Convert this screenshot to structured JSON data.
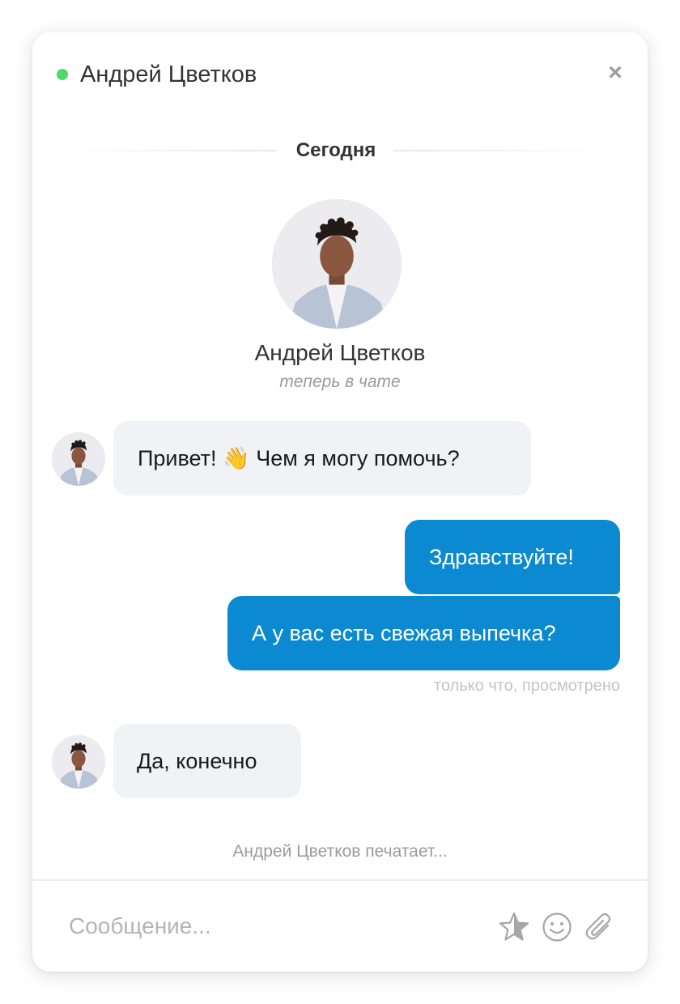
{
  "header": {
    "title": "Андрей Цветков",
    "status_icon": "online-dot",
    "online_color": "#4cd964",
    "close_label": "×"
  },
  "divider": {
    "label": "Сегодня"
  },
  "agent": {
    "name": "Андрей Цветков",
    "status": "теперь в чате"
  },
  "messages": [
    {
      "direction": "incoming",
      "text_before": "Привет!",
      "emoji": "👋",
      "text_after": "Чем я могу помочь?"
    },
    {
      "direction": "outgoing",
      "text": "Здравствуйте!"
    },
    {
      "direction": "outgoing",
      "text": "А у вас есть свежая выпечка?"
    },
    {
      "direction": "incoming",
      "text": "Да, конечно"
    }
  ],
  "outgoing_meta": "только что, просмотрено",
  "typing_indicator": "Андрей Цветков печатает...",
  "composer": {
    "placeholder": "Сообщение...",
    "value": "",
    "icons": [
      "star-icon",
      "smile-icon",
      "paperclip-icon"
    ]
  },
  "colors": {
    "outgoing_bubble": "#0b89d1",
    "incoming_bubble": "#f1f2f5",
    "accent_online": "#4cd964"
  }
}
